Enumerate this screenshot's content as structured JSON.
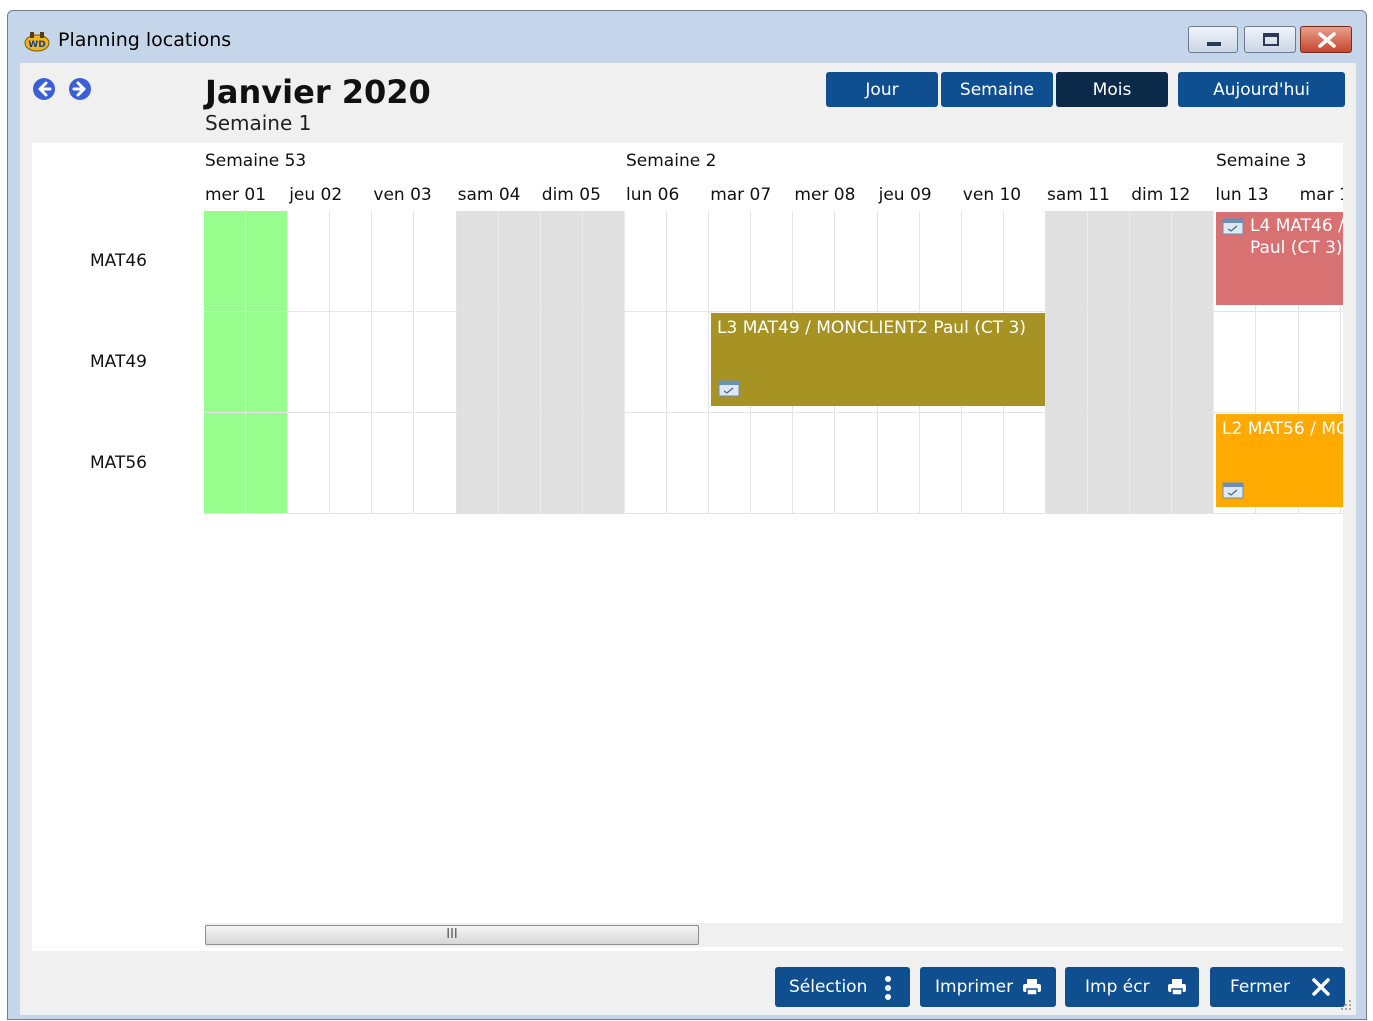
{
  "window": {
    "title": "Planning locations"
  },
  "header": {
    "month_title": "Janvier 2020",
    "week_subtitle": "Semaine 1"
  },
  "view_buttons": [
    {
      "label": "Jour",
      "active": false
    },
    {
      "label": "Semaine",
      "active": false
    },
    {
      "label": "Mois",
      "active": true
    },
    {
      "label": "Aujourd'hui",
      "active": false
    }
  ],
  "calendar": {
    "weeks": [
      "Semaine 53",
      "Semaine 2",
      "Semaine 3"
    ],
    "days": [
      {
        "label": "mer 01",
        "kind": "today"
      },
      {
        "label": "jeu 02",
        "kind": "work"
      },
      {
        "label": "ven 03",
        "kind": "work"
      },
      {
        "label": "sam 04",
        "kind": "weekend"
      },
      {
        "label": "dim 05",
        "kind": "weekend"
      },
      {
        "label": "lun 06",
        "kind": "work"
      },
      {
        "label": "mar 07",
        "kind": "work"
      },
      {
        "label": "mer 08",
        "kind": "work"
      },
      {
        "label": "jeu 09",
        "kind": "work"
      },
      {
        "label": "ven 10",
        "kind": "work"
      },
      {
        "label": "sam 11",
        "kind": "weekend"
      },
      {
        "label": "dim 12",
        "kind": "weekend"
      },
      {
        "label": "lun 13",
        "kind": "work"
      },
      {
        "label": "mar 1",
        "kind": "work"
      }
    ],
    "rows": [
      "MAT46",
      "MAT49",
      "MAT56"
    ],
    "events": [
      {
        "row": "MAT46",
        "text": "L4 MAT46 /\nPaul (CT 3)",
        "color": "#d87171"
      },
      {
        "row": "MAT49",
        "text": "L3 MAT49 / MONCLIENT2 Paul (CT 3)",
        "color": "#a69324"
      },
      {
        "row": "MAT56",
        "text": "L2 MAT56 / MO",
        "color": "#ffaa00"
      }
    ],
    "colors": {
      "today": "#97fe8e",
      "weekend": "#e0e0e0",
      "accent": "#0f4f8f"
    }
  },
  "scrollbar": {
    "thumb_glyph": "III"
  },
  "actions": [
    {
      "label": "Sélection",
      "icon": "more-vertical-icon"
    },
    {
      "label": "Imprimer",
      "icon": "printer-icon"
    },
    {
      "label": "Imp écr",
      "icon": "printer-icon"
    },
    {
      "label": "Fermer",
      "icon": "close-x-icon"
    }
  ]
}
